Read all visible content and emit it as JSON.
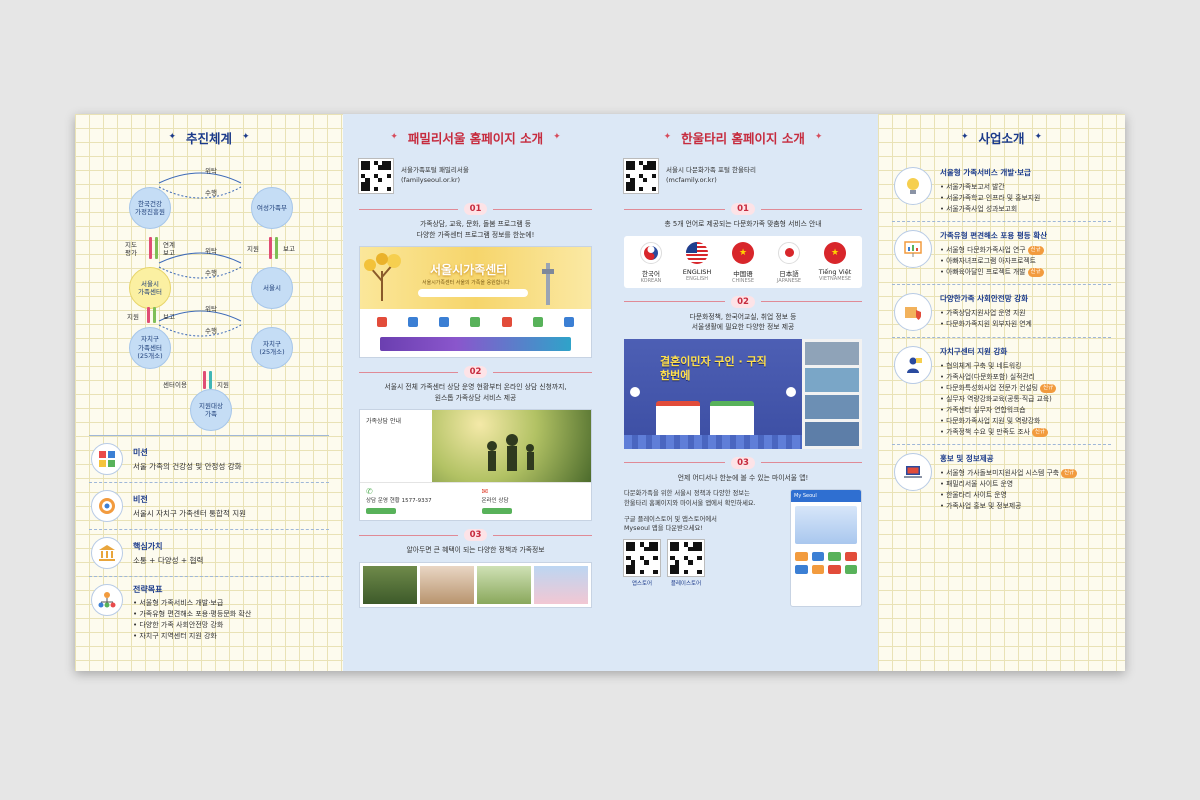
{
  "panel1": {
    "title": "추진체계",
    "org": {
      "nodes": [
        "한국건강가정진흥원",
        "여성가족부",
        "서울시 가족센터",
        "서울시",
        "자치구 가족센터 (25개소)",
        "자치구 (25개소)",
        "지원대상 가족"
      ],
      "node_lines": {
        "a": [
          "한국건강",
          "가정진흥원"
        ],
        "b": [
          "여성가족부"
        ],
        "c": [
          "서울시",
          "가족센터"
        ],
        "d": [
          "서울시"
        ],
        "e": [
          "자치구",
          "가족센터",
          "(25개소)"
        ],
        "f": [
          "자치구",
          "(25개소)"
        ],
        "g": [
          "지원대상",
          "가족"
        ]
      },
      "labels": {
        "wit1": "위탁",
        "su1": "수행",
        "wit2": "위탁",
        "su2": "수행",
        "wit3": "위탁",
        "su3": "수행",
        "jido": "지도",
        "pyeong": "평가",
        "yeon": "연계",
        "bo1": "보고",
        "ji1": "지원",
        "bo2": "보고",
        "ji2": "지원",
        "bo3": "보고",
        "center": "센터이용",
        "ji3": "지원"
      }
    },
    "mission": {
      "title": "미션",
      "text": "서울 가족의 건강성 및 안정성 강화"
    },
    "vision": {
      "title": "비전",
      "text": "서울시 자치구 가족센터 통합적 지원"
    },
    "values": {
      "title": "핵심가치",
      "text": "소통 + 다양성 + 협력"
    },
    "goals": {
      "title": "전략목표",
      "items": [
        "서울형 가족서비스 개발·보급",
        "가족유형 편견해소 포용·평등문화 확산",
        "다양한 가족 사회안전망 강화",
        "자치구 지역센터 지원 강화"
      ]
    }
  },
  "panel2": {
    "title": "패밀리서울 홈페이지 소개",
    "qr_line1": "서울가족포털 패밀리서울",
    "qr_line2": "(familyseoul.or.kr)",
    "s1": {
      "num": "01",
      "line1": "가족상담, 교육, 문화, 돌봄 프로그램 등",
      "line2": "다양한 가족센터 프로그램 정보를 한눈에!"
    },
    "s1_shot": {
      "title": "서울시가족센터",
      "subtitle": "서울시가족센터 서울의 가족을 응원합니다"
    },
    "s2": {
      "num": "02",
      "line1": "서울시 전체 가족센터 상담 운영 현황부터 온라인 상담 신청까지,",
      "line2": "원스톱 가족상담 서비스 제공"
    },
    "s2_shot": {
      "title": "가족상담 안내",
      "phone": "상담 운영 현황 1577-9337",
      "online": "온라인 상담"
    },
    "s3": {
      "num": "03",
      "line1": "알아두면 큰 혜택이 되는 다양한 정책과 가족정보"
    }
  },
  "panel3": {
    "title": "한울타리 홈페이지 소개",
    "qr_line1": "서울시 다문화가족 포털 한울타리",
    "qr_line2": "(mcfamily.or.kr)",
    "s1": {
      "num": "01",
      "line1": "총 5개 언어로 제공되는 다문화가족 맞춤형 서비스 안내"
    },
    "flags": [
      {
        "label": "한국어",
        "sub": "KOREAN",
        "color": "#ffffff"
      },
      {
        "label": "ENGLISH",
        "sub": "ENGLISH",
        "color": "#1e3f8f"
      },
      {
        "label": "中国语",
        "sub": "CHINESE",
        "color": "#d8262b"
      },
      {
        "label": "日本語",
        "sub": "JAPANESE",
        "color": "#ffffff"
      },
      {
        "label": "Tiếng Việt",
        "sub": "VIETNAMESE",
        "color": "#d8262b"
      }
    ],
    "s2": {
      "num": "02",
      "line1": "다문화정책, 한국어교실, 취업 정보 등",
      "line2": "서울생활에 필요한 다양한 정보 제공"
    },
    "s2_banner": "결혼이민자 구인 · 구직 한번에",
    "s3": {
      "num": "03",
      "line1": "언제 어디서나 한눈에 볼 수 있는 마이서울 앱!"
    },
    "app": {
      "p1": "다문화가족을 위한 서울시 정책과 다양한 정보는",
      "p2": "한울타리 홈페이지와 마이서울 앱에서 확인하세요.",
      "p3": "구글 플레이스토어 및 앱스토어에서",
      "p4": "Myseoul 앱을 다운받으세요!",
      "appstore": "앱스토어",
      "playstore": "플레이스토어",
      "phone_title": "My Seoul"
    }
  },
  "panel4": {
    "title": "사업소개",
    "items": [
      {
        "title": "서울형 가족서비스 개발·보급",
        "lines": [
          {
            "t": "서울가족보고서 발간"
          },
          {
            "t": "서울가족학교 인프라 및 홍보지원"
          },
          {
            "t": "서울가족사업 성과보고회"
          }
        ]
      },
      {
        "title": "가족유형 편견해소 포용 평등 확산",
        "lines": [
          {
            "t": "서울형 다문화가족사업 연구",
            "tag": "신규"
          },
          {
            "t": "아빠자녀프로그램 아자프로젝트"
          },
          {
            "t": "아빠육아달인 프로젝트 개발",
            "tag": "신규"
          }
        ]
      },
      {
        "title": "다양한가족 사회안전망 강화",
        "lines": [
          {
            "t": "가족상담지원사업 운영 지원"
          },
          {
            "t": "다문화가족지원 외부자원 연계"
          }
        ]
      },
      {
        "title": "자치구센터 지원 강화",
        "lines": [
          {
            "t": "협의체계 구축 및 네트워킹"
          },
          {
            "t": "가족사업(다문화포함) 실적관리"
          },
          {
            "t": "다문화특성화사업 전문가 컨설팅",
            "tag": "신규"
          },
          {
            "t": "실무자 역량강화교육(공통·직급 교육)"
          },
          {
            "t": "가족센터 실무자 연합워크숍"
          },
          {
            "t": "다문화가족사업 지원 및 역량강화"
          },
          {
            "t": "가족정책 수요 및 만족도 조사",
            "tag": "신규"
          }
        ]
      },
      {
        "title": "홍보 및 정보제공",
        "lines": [
          {
            "t": "서울형 가사돌보미지원사업 시스템 구축",
            "tag": "신규"
          },
          {
            "t": "패밀리서울 사이트 운영"
          },
          {
            "t": "한울타리 사이트 운영"
          },
          {
            "t": "가족사업 홍보 및 정보제공"
          }
        ]
      }
    ]
  },
  "colors": {
    "navy": "#1b3a8a",
    "red": "#c62b3e",
    "blue_bg": "#dce8f6",
    "grid_bg": "#fdfbee"
  }
}
